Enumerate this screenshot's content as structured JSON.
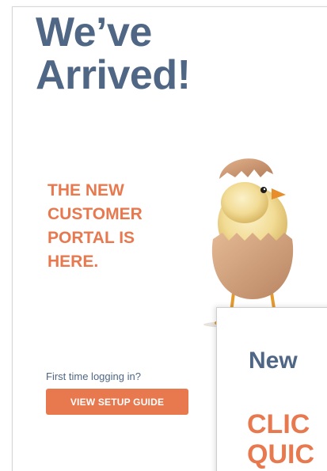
{
  "main": {
    "headline_line1": "We’ve",
    "headline_line2": "Arrived!",
    "subhead_line1": "THE NEW",
    "subhead_line2": "CUSTOMER",
    "subhead_line3": "PORTAL IS",
    "subhead_line4": "HERE.",
    "first_time_text": "First time logging in?",
    "guide_button_label": "VIEW SETUP GUIDE",
    "illustration_icon": "chick-in-egg-icon"
  },
  "overlay": {
    "title": "New",
    "cta_line1": "CLIC",
    "cta_line2": "QUIC"
  },
  "colors": {
    "headline": "#4f6685",
    "accent": "#e8794f",
    "background": "#ffffff"
  }
}
